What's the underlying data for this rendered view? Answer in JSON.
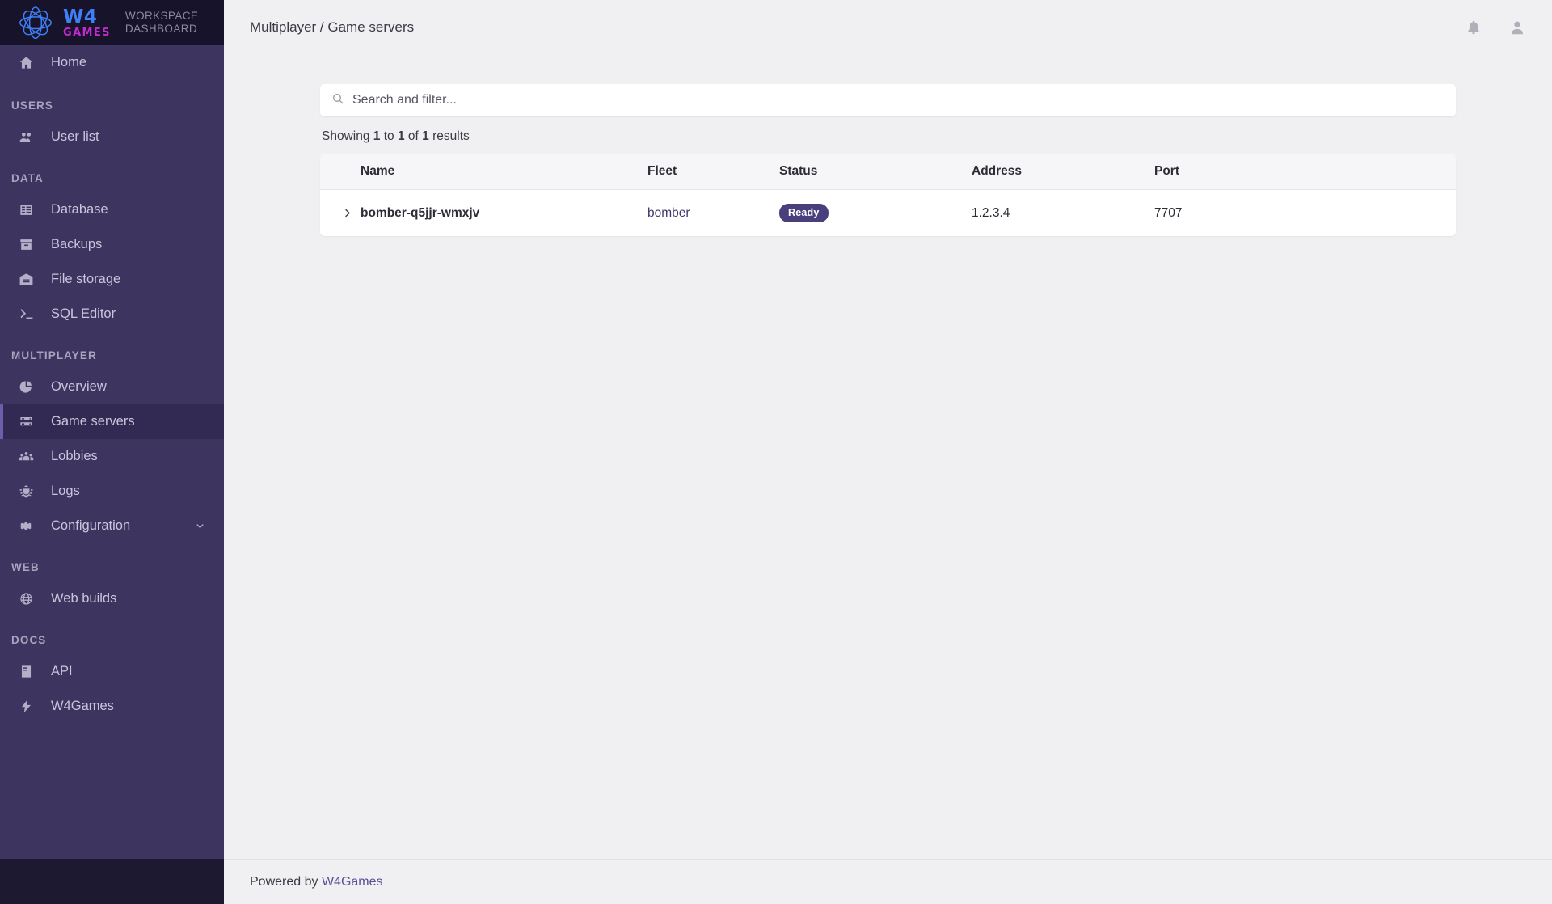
{
  "brand": {
    "logo_w4": "W4",
    "logo_games": "GAMES",
    "subtitle_line1": "WORKSPACE",
    "subtitle_line2": "DASHBOARD",
    "logo_blue": "#3f7ff5",
    "logo_magenta": "#c42ad0"
  },
  "sidebar": {
    "home": {
      "label": "Home",
      "icon": "home-icon"
    },
    "sections": [
      {
        "title": "USERS",
        "items": [
          {
            "label": "User list",
            "icon": "users-icon"
          }
        ]
      },
      {
        "title": "DATA",
        "items": [
          {
            "label": "Database",
            "icon": "database-table-icon"
          },
          {
            "label": "Backups",
            "icon": "archive-box-icon"
          },
          {
            "label": "File storage",
            "icon": "file-storage-icon"
          },
          {
            "label": "SQL Editor",
            "icon": "terminal-icon"
          }
        ]
      },
      {
        "title": "MULTIPLAYER",
        "items": [
          {
            "label": "Overview",
            "icon": "pie-chart-icon"
          },
          {
            "label": "Game servers",
            "icon": "server-icon",
            "active": true
          },
          {
            "label": "Lobbies",
            "icon": "lobby-people-icon"
          },
          {
            "label": "Logs",
            "icon": "bug-icon"
          },
          {
            "label": "Configuration",
            "icon": "gear-icon",
            "expandable": true
          }
        ]
      },
      {
        "title": "WEB",
        "items": [
          {
            "label": "Web builds",
            "icon": "globe-icon"
          }
        ]
      },
      {
        "title": "DOCS",
        "items": [
          {
            "label": "API",
            "icon": "book-icon"
          },
          {
            "label": "W4Games",
            "icon": "bolt-icon"
          }
        ]
      }
    ]
  },
  "topbar": {
    "breadcrumb": "Multiplayer / Game servers",
    "notifications_icon": "bell-icon",
    "account_icon": "user-avatar-icon"
  },
  "search": {
    "placeholder": "Search and filter...",
    "value": "",
    "icon": "search-icon"
  },
  "results": {
    "prefix": "Showing",
    "from": "1",
    "mid": "to",
    "to": "1",
    "of": "of",
    "total": "1",
    "suffix": "results"
  },
  "table": {
    "columns": [
      "Name",
      "Fleet",
      "Status",
      "Address",
      "Port"
    ],
    "rows": [
      {
        "name": "bomber-q5jjr-wmxjv",
        "fleet": "bomber",
        "status": "Ready",
        "status_color": "#4a3f7d",
        "address": "1.2.3.4",
        "port": "7707",
        "expand_icon": "chevron-right-icon"
      }
    ]
  },
  "footer": {
    "text": "Powered by",
    "link": "W4Games"
  }
}
